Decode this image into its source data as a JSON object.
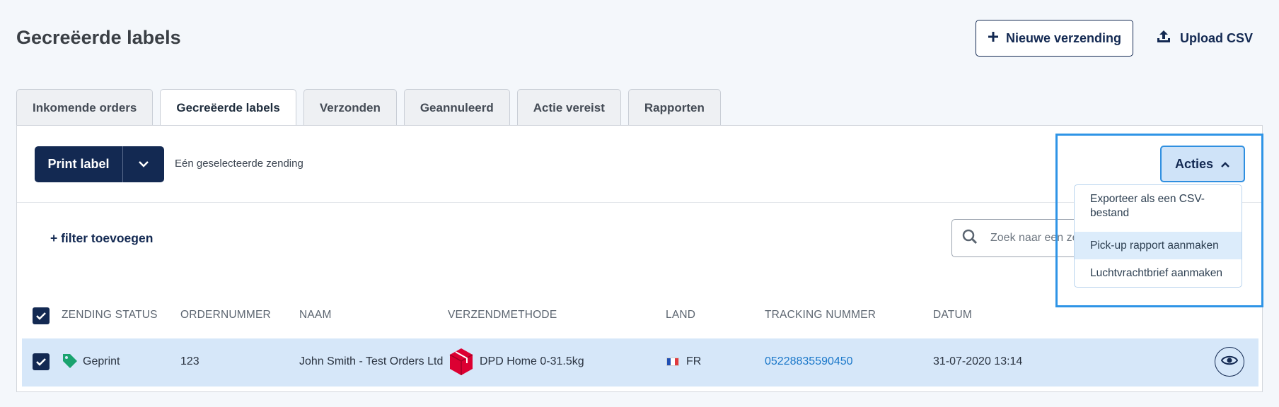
{
  "page": {
    "title": "Gecreëerde labels",
    "new_shipment_label": "Nieuwe verzending",
    "upload_csv_label": "Upload CSV"
  },
  "tabs": [
    {
      "label": "Inkomende orders",
      "active": false
    },
    {
      "label": "Gecreëerde labels",
      "active": true
    },
    {
      "label": "Verzonden",
      "active": false
    },
    {
      "label": "Geannuleerd",
      "active": false
    },
    {
      "label": "Actie vereist",
      "active": false
    },
    {
      "label": "Rapporten",
      "active": false
    }
  ],
  "toolbar": {
    "print_label": "Print label",
    "selected_text": "Eén geselecteerde zending",
    "actions_label": "Acties"
  },
  "actions_menu": {
    "items": [
      "Exporteer als een CSV-bestand",
      "Pick-up rapport aanmaken",
      "Luchtvrachtbrief aanmaken"
    ],
    "highlighted_index": 1
  },
  "filter": {
    "add_filter_label": "+ filter toevoegen",
    "search_placeholder": "Zoek naar een zending"
  },
  "table": {
    "headers": {
      "status": "ZENDING STATUS",
      "order": "ORDERNUMMER",
      "name": "NAAM",
      "method": "VERZENDMETHODE",
      "country": "LAND",
      "tracking": "TRACKING NUMMER",
      "date": "DATUM"
    },
    "rows": [
      {
        "status": "Geprint",
        "order": "123",
        "name": "John Smith - Test Orders Ltd",
        "method": "DPD Home 0-31.5kg",
        "country": "FR",
        "tracking": "05228835590450",
        "date": "31-07-2020 13:14"
      }
    ]
  },
  "colors": {
    "navy": "#132952",
    "accent_blue": "#2e94e6",
    "row_selected": "#d6e7f9",
    "tag_green": "#1aa36f",
    "dpd_red": "#dc0032"
  },
  "icons": {
    "plus": "plus-icon",
    "upload": "upload-icon",
    "chevron_down": "chevron-down-icon",
    "chevron_up": "chevron-up-icon",
    "search": "search-icon",
    "tag": "tag-icon",
    "dpd": "dpd-logo-icon",
    "flag": "france-flag-icon",
    "eye": "eye-icon"
  }
}
